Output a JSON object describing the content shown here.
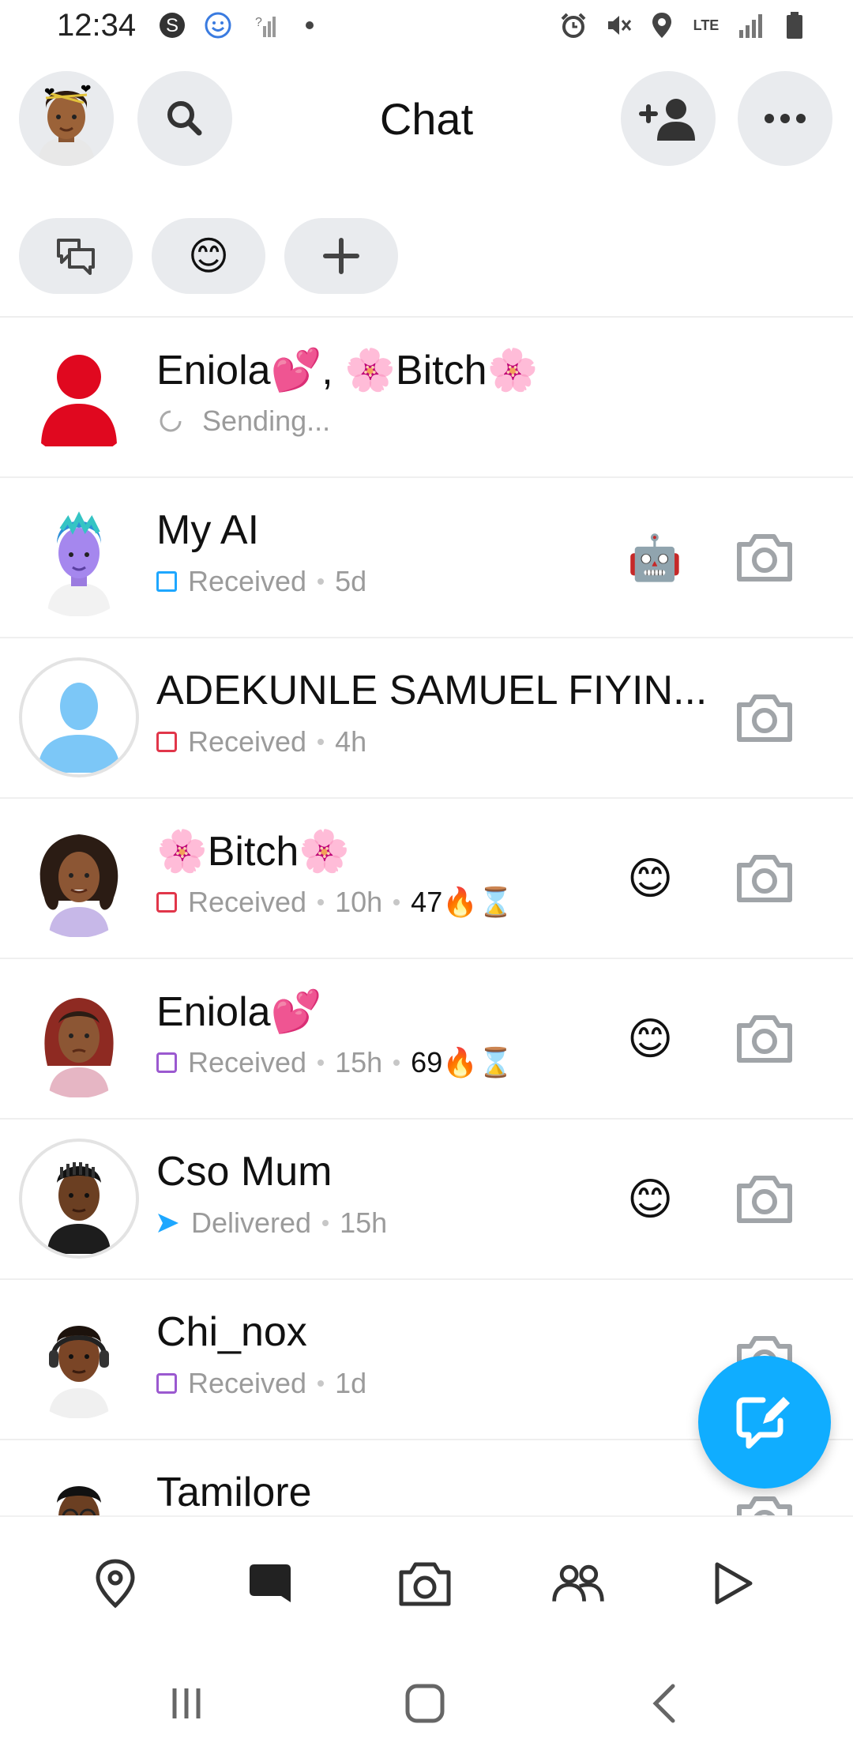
{
  "status_bar": {
    "time": "12:34",
    "left_icons": [
      "snapchat-s-icon",
      "smiley-status-icon",
      "signal-question-icon",
      "dot-icon"
    ],
    "right_icons": [
      "alarm-icon",
      "mute-icon",
      "location-pin-icon",
      "lte-icon",
      "signal-bars-icon",
      "battery-icon"
    ],
    "network_label": "LTE"
  },
  "header": {
    "title": "Chat"
  },
  "filters": [
    {
      "name": "chats-filter",
      "icon": "chat-bubbles-icon"
    },
    {
      "name": "emoji-filter",
      "icon": "smile-emoji-icon",
      "glyph": "😊"
    },
    {
      "name": "add-filter",
      "icon": "plus-icon"
    }
  ],
  "chats": [
    {
      "name": "Eniola💕, 🌸Bitch🌸",
      "status": "Sending...",
      "status_type": "sending",
      "avatar": "red-silhouette",
      "emoji": "",
      "camera": false
    },
    {
      "name": "My AI",
      "status": "Received",
      "time": "5d",
      "status_type": "received-blue",
      "avatar": "purple-bitmoji",
      "emoji": "🤖",
      "camera": true
    },
    {
      "name": "ADEKUNLE SAMUEL FIYIN...",
      "status": "Received",
      "time": "4h",
      "status_type": "received-red",
      "avatar": "blue-silhouette",
      "emoji": "",
      "camera": true
    },
    {
      "name": "🌸Bitch🌸",
      "status": "Received",
      "time": "10h",
      "streak": "47🔥⌛",
      "status_type": "received-red",
      "avatar": "bitmoji-curly-hair",
      "emoji": "😊",
      "camera": true
    },
    {
      "name": "Eniola💕",
      "status": "Received",
      "time": "15h",
      "streak": "69🔥⌛",
      "status_type": "received-purple",
      "avatar": "bitmoji-red-hair",
      "emoji": "😊",
      "camera": true
    },
    {
      "name": "Cso Mum",
      "status": "Delivered",
      "time": "15h",
      "status_type": "delivered",
      "avatar": "bitmoji-braids-ring",
      "emoji": "😊",
      "camera": true
    },
    {
      "name": "Chi_nox",
      "status": "Received",
      "time": "1d",
      "status_type": "received-purple",
      "avatar": "bitmoji-headphones",
      "emoji": "",
      "camera": true
    },
    {
      "name": "Tamilore",
      "status": "",
      "status_type": "received-red",
      "avatar": "bitmoji-glasses",
      "emoji": "",
      "camera": true
    }
  ],
  "colors": {
    "accent_blue": "#10adff",
    "received_red": "#e1364a",
    "received_purple": "#9b59d0",
    "received_blue": "#1ea7ff",
    "pill_bg": "#e9ebee"
  },
  "bottom_nav": [
    "map-icon",
    "chat-icon",
    "camera-icon",
    "friends-icon",
    "stories-play-icon"
  ],
  "system_nav": [
    "recents-icon",
    "home-icon",
    "back-icon"
  ]
}
